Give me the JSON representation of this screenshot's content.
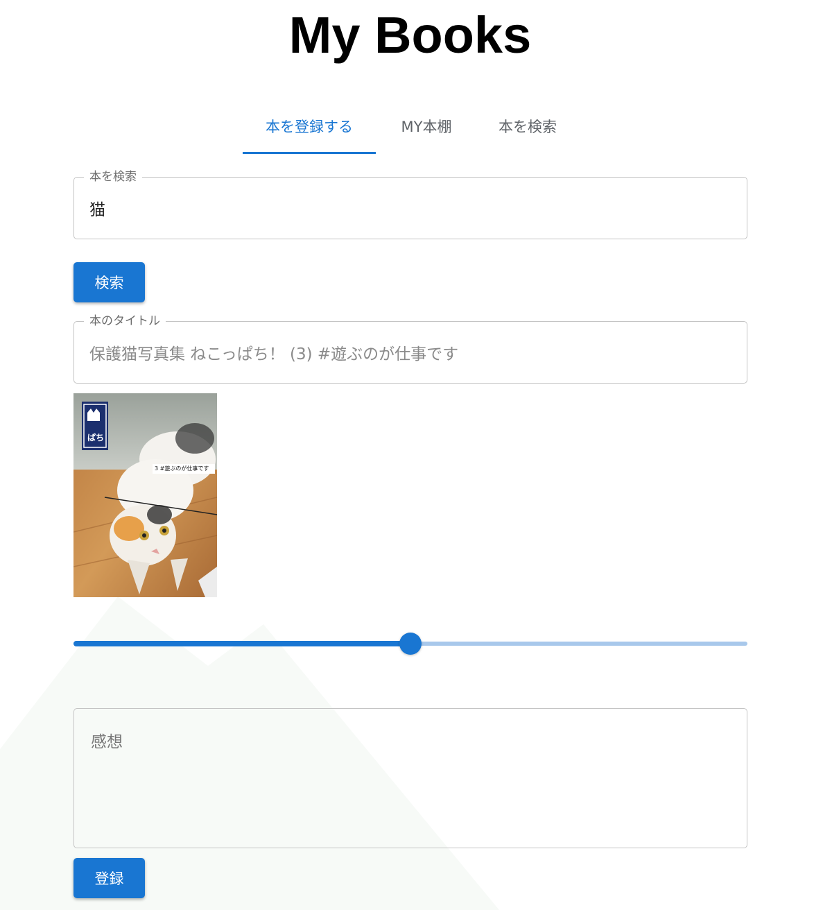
{
  "app": {
    "title": "My Books"
  },
  "tabs": [
    {
      "label": "本を登録する",
      "active": true
    },
    {
      "label": "MY本棚",
      "active": false
    },
    {
      "label": "本を検索",
      "active": false
    }
  ],
  "search": {
    "legend": "本を検索",
    "value": "猫",
    "button_label": "検索"
  },
  "book": {
    "title_legend": "本のタイトル",
    "title_value": "保護猫写真集 ねこっぱち！ (3) #遊ぶのが仕事です",
    "cover_lettering": {
      "brand": "ぱち",
      "subtitle": "3 #遊ぶのが仕事です"
    }
  },
  "rating": {
    "min": 0,
    "max": 1,
    "value": 0.5
  },
  "review": {
    "placeholder": "感想",
    "value": ""
  },
  "submit": {
    "label": "登録"
  },
  "colors": {
    "primary": "#1976d2",
    "rail": "#a8c8eb",
    "border": "#c4c4c4"
  },
  "icons": {
    "cover": "cat-photo-book-cover"
  }
}
